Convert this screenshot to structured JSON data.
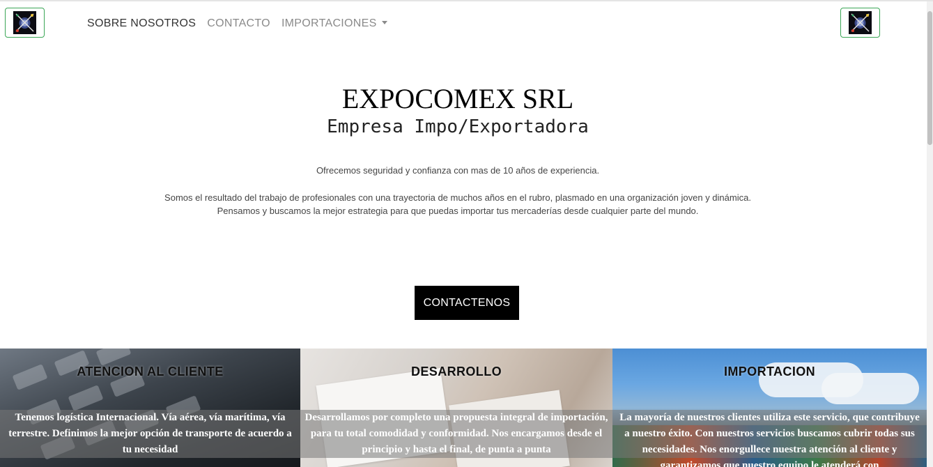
{
  "brand": {
    "logo_left_icon": "expocomex-logo-icon",
    "logo_right_icon": "expocomex-logo-icon",
    "border_color": "#3aa655"
  },
  "nav": {
    "items": [
      {
        "label": "SOBRE NOSOTROS"
      },
      {
        "label": "CONTACTO"
      },
      {
        "label": "IMPORTACIONES",
        "icon": "chevron-down-icon"
      }
    ]
  },
  "hero": {
    "title": "EXPOCOMEX SRL",
    "subtitle": "Empresa Impo/Exportadora",
    "line1": "Ofrecemos seguridad y confianza con mas de 10 años de experiencia.",
    "line2": "Somos el resultado del trabajo de profesionales con una trayectoria de muchos años en el rubro, plasmado en una organización joven y dinámica.",
    "line3": "Pensamos y buscamos la mejor estrategia para que puedas importar tus mercaderías desde cualquier parte del mundo.",
    "cta_label": "CONTACTENOS"
  },
  "panels": [
    {
      "title": "ATENCION AL CLIENTE",
      "text": "Tenemos logística Internacional. Vía aérea, vía marítima, vía terrestre. Definimos la mejor opción de transporte de acuerdo a tu necesidad"
    },
    {
      "title": "DESARROLLO",
      "text": "Desarrollamos por completo una propuesta integral de importación, para tu total comodidad y conformidad. Nos encargamos desde el principio y hasta el final, de punta a punta"
    },
    {
      "title": "IMPORTACION",
      "text": "La mayoría de nuestros clientes utiliza este servicio, que contribuye a nuestro éxito. Con nuestros servicios buscamos cubrir todas sus necesidades. Nos enorgullece nuestra atención al cliente y garantizamos que nuestro equipo le atenderá con"
    }
  ]
}
